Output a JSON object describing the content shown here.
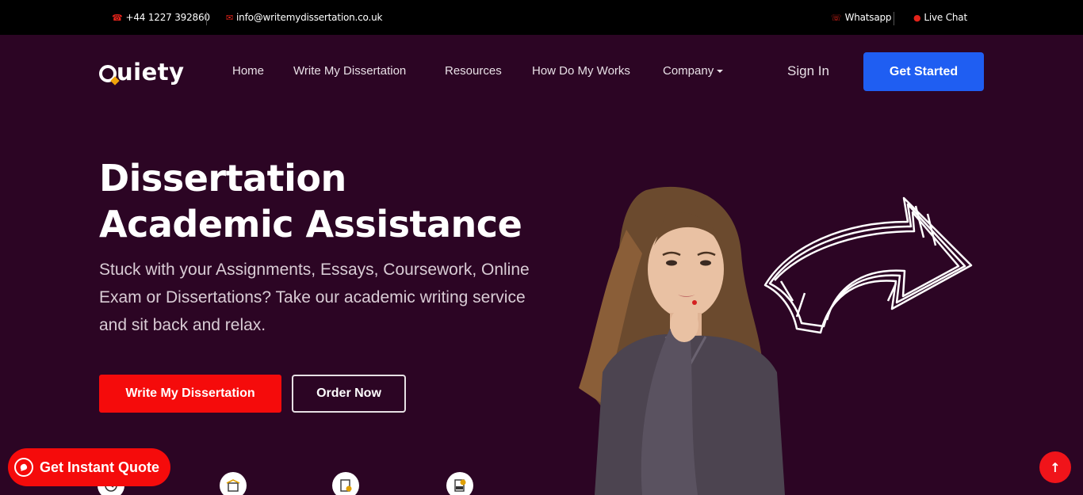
{
  "topbar": {
    "phone": "+44 1227 392860",
    "email": "info@writemydissertation.co.uk",
    "whatsapp": "Whatsapp",
    "livechat": "Live Chat"
  },
  "brand": {
    "logo_text": "uiety",
    "logo_initial_icon": "q-logo-icon"
  },
  "nav": {
    "items": [
      "Home",
      "Write My Dissertation",
      "Resources",
      "How Do My Works",
      "Company"
    ],
    "signin": "Sign In",
    "cta": "Get Started"
  },
  "hero": {
    "title_line1": "Dissertation",
    "title_line2": "Academic Assistance",
    "subtitle": "Stuck with your Assignments, Essays, Coursework, Online Exam or Dissertations? Take our academic writing service and sit back and relax.",
    "primary_button": "Write My Dissertation",
    "secondary_button": "Order Now"
  },
  "floating": {
    "quote_button": "Get Instant Quote",
    "back_to_top_icon": "arrow-up-icon"
  },
  "colors": {
    "background": "#2c0524",
    "topbar": "#000000",
    "primary_red": "#f50b0b",
    "cta_blue": "#1f5ef2"
  }
}
